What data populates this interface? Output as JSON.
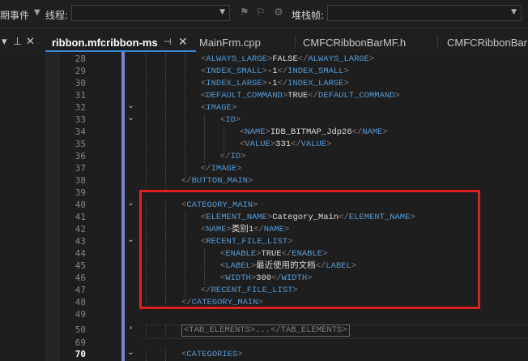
{
  "toolbar": {
    "lifecycle_label": "期事件",
    "thread_label": "线程:",
    "thread_value": "",
    "stackframe_label": "堆栈帧:",
    "stackframe_value": ""
  },
  "tabs": [
    {
      "label": "ribbon.mfcribbon-ms",
      "active": true
    },
    {
      "label": "MainFrm.cpp",
      "active": false
    },
    {
      "label": "CMFCRibbonBarMF.h",
      "active": false
    },
    {
      "label": "CMFCRibbonBarM",
      "active": false
    }
  ],
  "lines": [
    {
      "num": "28",
      "segments": [
        [
          "br",
          "<"
        ],
        [
          "tag",
          "ALWAYS_LARGE"
        ],
        [
          "br",
          ">"
        ],
        [
          "txt",
          "FALSE"
        ],
        [
          "br",
          "</"
        ],
        [
          "tag",
          "ALWAYS_LARGE"
        ],
        [
          "br",
          ">"
        ]
      ]
    },
    {
      "num": "29",
      "segments": [
        [
          "br",
          "<"
        ],
        [
          "tag",
          "INDEX_SMALL"
        ],
        [
          "br",
          ">"
        ],
        [
          "txt",
          "-1"
        ],
        [
          "br",
          "</"
        ],
        [
          "tag",
          "INDEX_SMALL"
        ],
        [
          "br",
          ">"
        ]
      ]
    },
    {
      "num": "30",
      "segments": [
        [
          "br",
          "<"
        ],
        [
          "tag",
          "INDEX_LARGE"
        ],
        [
          "br",
          ">"
        ],
        [
          "txt",
          "-1"
        ],
        [
          "br",
          "</"
        ],
        [
          "tag",
          "INDEX_LARGE"
        ],
        [
          "br",
          ">"
        ]
      ]
    },
    {
      "num": "31",
      "segments": [
        [
          "br",
          "<"
        ],
        [
          "tag",
          "DEFAULT_COMMAND"
        ],
        [
          "br",
          ">"
        ],
        [
          "txt",
          "TRUE"
        ],
        [
          "br",
          "</"
        ],
        [
          "tag",
          "DEFAULT_COMMAND"
        ],
        [
          "br",
          ">"
        ]
      ]
    },
    {
      "num": "32",
      "segments": [
        [
          "br",
          "<"
        ],
        [
          "tag",
          "IMAGE"
        ],
        [
          "br",
          ">"
        ]
      ]
    },
    {
      "num": "33",
      "segments": [
        [
          "br",
          "<"
        ],
        [
          "tag",
          "ID"
        ],
        [
          "br",
          ">"
        ]
      ]
    },
    {
      "num": "34",
      "segments": [
        [
          "br",
          "<"
        ],
        [
          "tag",
          "NAME"
        ],
        [
          "br",
          ">"
        ],
        [
          "txt",
          "IDB_BITMAP_Jdp26"
        ],
        [
          "br",
          "</"
        ],
        [
          "tag",
          "NAME"
        ],
        [
          "br",
          ">"
        ]
      ]
    },
    {
      "num": "35",
      "segments": [
        [
          "br",
          "<"
        ],
        [
          "tag",
          "VALUE"
        ],
        [
          "br",
          ">"
        ],
        [
          "txt",
          "331"
        ],
        [
          "br",
          "</"
        ],
        [
          "tag",
          "VALUE"
        ],
        [
          "br",
          ">"
        ]
      ]
    },
    {
      "num": "36",
      "segments": [
        [
          "br",
          "</"
        ],
        [
          "tag",
          "ID"
        ],
        [
          "br",
          ">"
        ]
      ]
    },
    {
      "num": "37",
      "segments": [
        [
          "br",
          "</"
        ],
        [
          "tag",
          "IMAGE"
        ],
        [
          "br",
          ">"
        ]
      ]
    },
    {
      "num": "38",
      "segments": [
        [
          "br",
          "</"
        ],
        [
          "tag",
          "BUTTON_MAIN"
        ],
        [
          "br",
          ">"
        ]
      ]
    },
    {
      "num": "39",
      "segments": []
    },
    {
      "num": "40",
      "segments": [
        [
          "br",
          "<"
        ],
        [
          "tag",
          "CATEGORY_MAIN"
        ],
        [
          "br",
          ">"
        ]
      ]
    },
    {
      "num": "41",
      "segments": [
        [
          "br",
          "<"
        ],
        [
          "tag",
          "ELEMENT_NAME"
        ],
        [
          "br",
          ">"
        ],
        [
          "txt",
          "Category_Main"
        ],
        [
          "br",
          "</"
        ],
        [
          "tag",
          "ELEMENT_NAME"
        ],
        [
          "br",
          ">"
        ]
      ]
    },
    {
      "num": "42",
      "segments": [
        [
          "br",
          "<"
        ],
        [
          "tag",
          "NAME"
        ],
        [
          "br",
          ">"
        ],
        [
          "txt",
          "类别1"
        ],
        [
          "br",
          "</"
        ],
        [
          "tag",
          "NAME"
        ],
        [
          "br",
          ">"
        ]
      ]
    },
    {
      "num": "43",
      "segments": [
        [
          "br",
          "<"
        ],
        [
          "tag",
          "RECENT_FILE_LIST"
        ],
        [
          "br",
          ">"
        ]
      ]
    },
    {
      "num": "44",
      "segments": [
        [
          "br",
          "<"
        ],
        [
          "tag",
          "ENABLE"
        ],
        [
          "br",
          ">"
        ],
        [
          "txt",
          "TRUE"
        ],
        [
          "br",
          "</"
        ],
        [
          "tag",
          "ENABLE"
        ],
        [
          "br",
          ">"
        ]
      ]
    },
    {
      "num": "45",
      "segments": [
        [
          "br",
          "<"
        ],
        [
          "tag",
          "LABEL"
        ],
        [
          "br",
          ">"
        ],
        [
          "txt",
          "最近使用的文档"
        ],
        [
          "br",
          "</"
        ],
        [
          "tag",
          "LABEL"
        ],
        [
          "br",
          ">"
        ]
      ]
    },
    {
      "num": "46",
      "segments": [
        [
          "br",
          "<"
        ],
        [
          "tag",
          "WIDTH"
        ],
        [
          "br",
          ">"
        ],
        [
          "txt",
          "300"
        ],
        [
          "br",
          "</"
        ],
        [
          "tag",
          "WIDTH"
        ],
        [
          "br",
          ">"
        ]
      ]
    },
    {
      "num": "47",
      "segments": [
        [
          "br",
          "</"
        ],
        [
          "tag",
          "RECENT_FILE_LIST"
        ],
        [
          "br",
          ">"
        ]
      ]
    },
    {
      "num": "48",
      "segments": [
        [
          "br",
          "</"
        ],
        [
          "tag",
          "CATEGORY_MAIN"
        ],
        [
          "br",
          ">"
        ]
      ]
    },
    {
      "num": "49",
      "segments": []
    },
    {
      "num": "50",
      "collapsed": "<TAB_ELEMENTS>...</TAB_ELEMENTS>"
    },
    {
      "num": "69",
      "segments": []
    },
    {
      "num": "70",
      "segments": [
        [
          "br",
          "<"
        ],
        [
          "tag",
          "CATEGORIES"
        ],
        [
          "br",
          ">"
        ]
      ]
    }
  ],
  "colors": {
    "tag": "#569cd6",
    "text": "#dcdcdc",
    "highlight": "#e0211f",
    "change_bar": "#7e83ce"
  }
}
